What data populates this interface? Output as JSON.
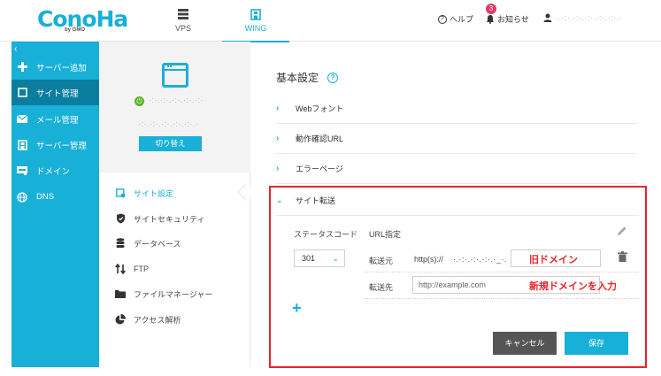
{
  "header": {
    "logo": "ConoHa",
    "logo_sub": "by GMO",
    "nav": [
      {
        "label": "VPS",
        "icon": "server-icon"
      },
      {
        "label": "WING",
        "icon": "wing-building-icon"
      }
    ],
    "help": "ヘルプ",
    "notifications": "お知らせ",
    "notification_count": "3",
    "user_name": "·.·:·.·:·.·:·.·:·.·:·.·"
  },
  "sidebar": {
    "collapse": "‹",
    "items": [
      {
        "label": "サーバー追加",
        "icon": "plus-icon"
      },
      {
        "label": "サイト管理",
        "icon": "window-icon"
      },
      {
        "label": "メール管理",
        "icon": "mail-icon"
      },
      {
        "label": "サーバー管理",
        "icon": "building-icon"
      },
      {
        "label": "ドメイン",
        "icon": "domain-icon"
      },
      {
        "label": "DNS",
        "icon": "globe-icon"
      }
    ]
  },
  "server_panel": {
    "name": "·:·.·:·.·:·.·:·.·:·",
    "sub": "·:·.·:·.·:·.·:·.·:·.·",
    "switch_button": "切り替え"
  },
  "site_menu": [
    {
      "label": "サイト設定",
      "icon": "site-settings-icon"
    },
    {
      "label": "サイトセキュリティ",
      "icon": "shield-icon"
    },
    {
      "label": "データベース",
      "icon": "database-icon"
    },
    {
      "label": "FTP",
      "icon": "updown-arrows-icon"
    },
    {
      "label": "ファイルマネージャー",
      "icon": "folder-icon"
    },
    {
      "label": "アクセス解析",
      "icon": "pie-chart-icon"
    }
  ],
  "main": {
    "title": "基本設定",
    "help_icon": "?",
    "accordion": [
      {
        "label": "Webフォント"
      },
      {
        "label": "動作確認URL"
      },
      {
        "label": "エラーページ"
      }
    ],
    "redirect": {
      "label": "サイト転送",
      "status_code_label": "ステータスコード",
      "url_label": "URL指定",
      "status_value": "301",
      "from_label": "転送元",
      "from_prefix": "http(s)://",
      "from_value": "·.·:·.·:·.·:·.·_·.",
      "from_annotation": "旧ドメイン",
      "to_label": "転送先",
      "to_placeholder": "http://example.com",
      "to_annotation": "新規ドメインを入力",
      "add": "+",
      "cancel": "キャンセル",
      "save": "保存"
    }
  }
}
